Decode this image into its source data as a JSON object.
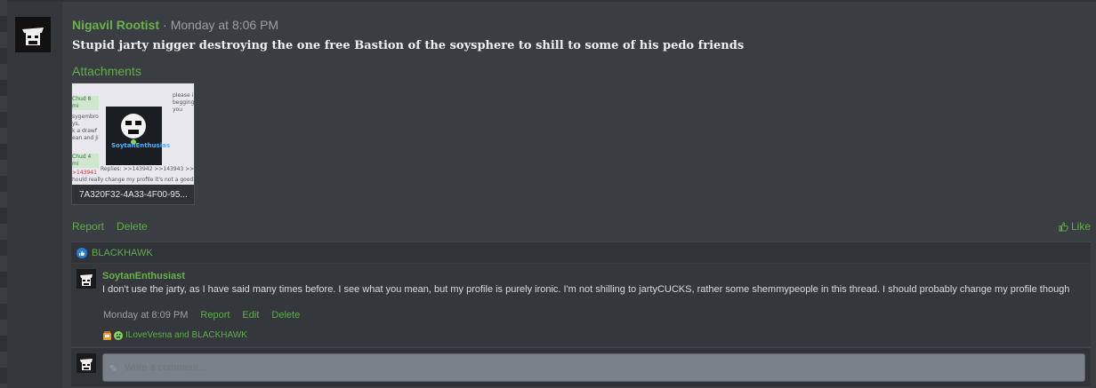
{
  "post": {
    "username": "Nigavil Rootist",
    "separator": "·",
    "timestamp": "Monday at 8:06 PM",
    "text": "Stupid jarty nigger destroying the one free Bastion of the soysphere to shill to some of his pedo friends",
    "attachments_label": "Attachments",
    "attachment": {
      "filename": "7A320F32-4A33-4F00-95...",
      "thumb_lines_left": [
        "Chud 8 mi",
        "sygembro",
        "ys.",
        "k a drawf",
        "ean and Ji",
        "Chud 4 mi",
        ">143941",
        "hould really change my profile it's not a good look"
      ],
      "thumb_lines_right": [
        "please i",
        "begging",
        "you"
      ],
      "thumb_name": "SoytanEnthusias",
      "thumb_replies": "Replies: >>143942 >>143943 >>143944 >>1"
    },
    "actions": {
      "report": "Report",
      "delete": "Delete"
    },
    "like_label": "Like"
  },
  "reactions": {
    "user": "BLACKHAWK",
    "icon": "thumbs-up-badge-icon"
  },
  "comment": {
    "username": "SoytanEnthusiast",
    "text": "I don't use the jarty, as I have said many times before. I see what you mean, but my profile is purely ironic. I'm not shilling to jartyCUCKS, rather some shemmypeople in this thread. I should probably change my profile though",
    "timestamp": "Monday at 8:09 PM",
    "report": "Report",
    "edit": "Edit",
    "delete": "Delete",
    "reaction_users": "ILoveVesna and BLACKHAWK"
  },
  "reply": {
    "placeholder": "Write a comment..."
  },
  "colors": {
    "accent_green": "#5fae4b",
    "bg": "#3a3d42",
    "input_bg": "#7b818a"
  }
}
